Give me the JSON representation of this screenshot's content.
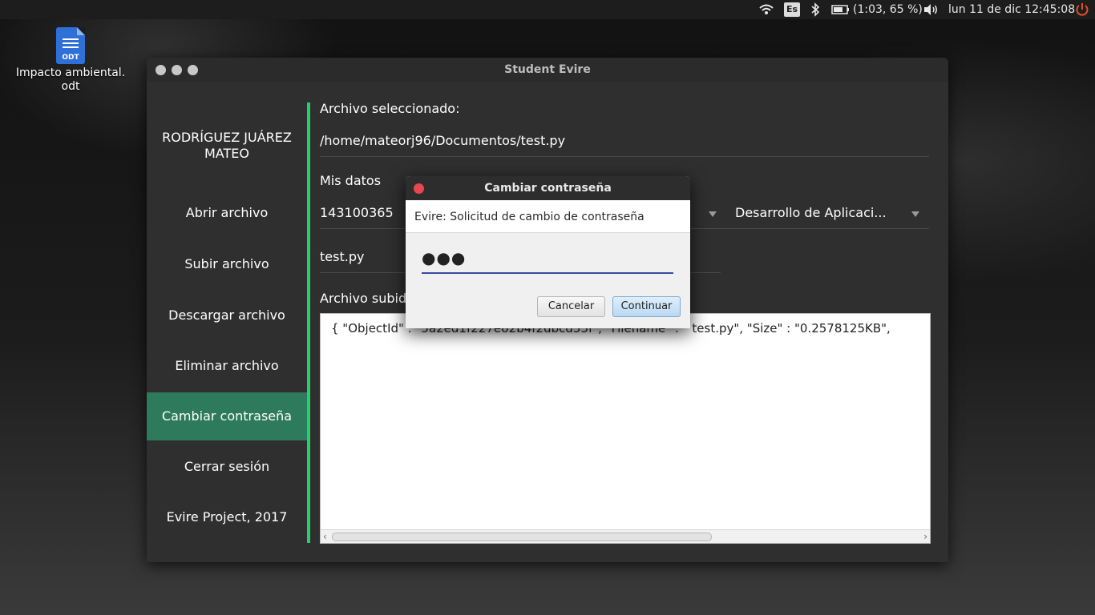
{
  "topbar": {
    "keyboard_layout": "Es",
    "battery": "(1:03, 65 %)",
    "datetime": "lun 11 de dic 12:45:08"
  },
  "desktop": {
    "file_icon_label": "ODT",
    "file_name": "Impacto ambiental.\nodt"
  },
  "window": {
    "title": "Student Evire"
  },
  "sidebar": {
    "user_name": "RODRÍGUEZ JUÁREZ MATEO",
    "items": [
      {
        "label": "Abrir archivo"
      },
      {
        "label": "Subir archivo"
      },
      {
        "label": "Descargar archivo"
      },
      {
        "label": "Eliminar archivo"
      },
      {
        "label": "Cambiar contraseña"
      },
      {
        "label": "Cerrar sesión"
      },
      {
        "label": "Evire Project, 2017"
      }
    ],
    "active_index": 4
  },
  "main": {
    "selected_file_label": "Archivo seleccionado:",
    "selected_file_path": "/home/mateorj96/Documentos/test.py",
    "my_data_label": "Mis datos",
    "student_id": "143100365",
    "subject": "Desarrollo de Aplicaci...",
    "file_name": "test.py",
    "uploaded_label": "Archivo subid",
    "uploaded_json": "{ \"ObjectId\" : \"5a2ed1f227e82b4f2dbcd55f\", \"Filename\" : \" test.py\", \"Size\" : \"0.2578125KB\","
  },
  "dialog": {
    "title": "Cambiar contraseña",
    "header": "Evire: Solicitud de cambio de contraseña",
    "password_value": "●●●",
    "cancel_label": "Cancelar",
    "continue_label": "Continuar"
  },
  "colors": {
    "sidebar_active": "#2d7a5c",
    "accent_bar": "#1fd36a",
    "close_button": "#e8474f",
    "field_underline": "#3a4aa0"
  }
}
